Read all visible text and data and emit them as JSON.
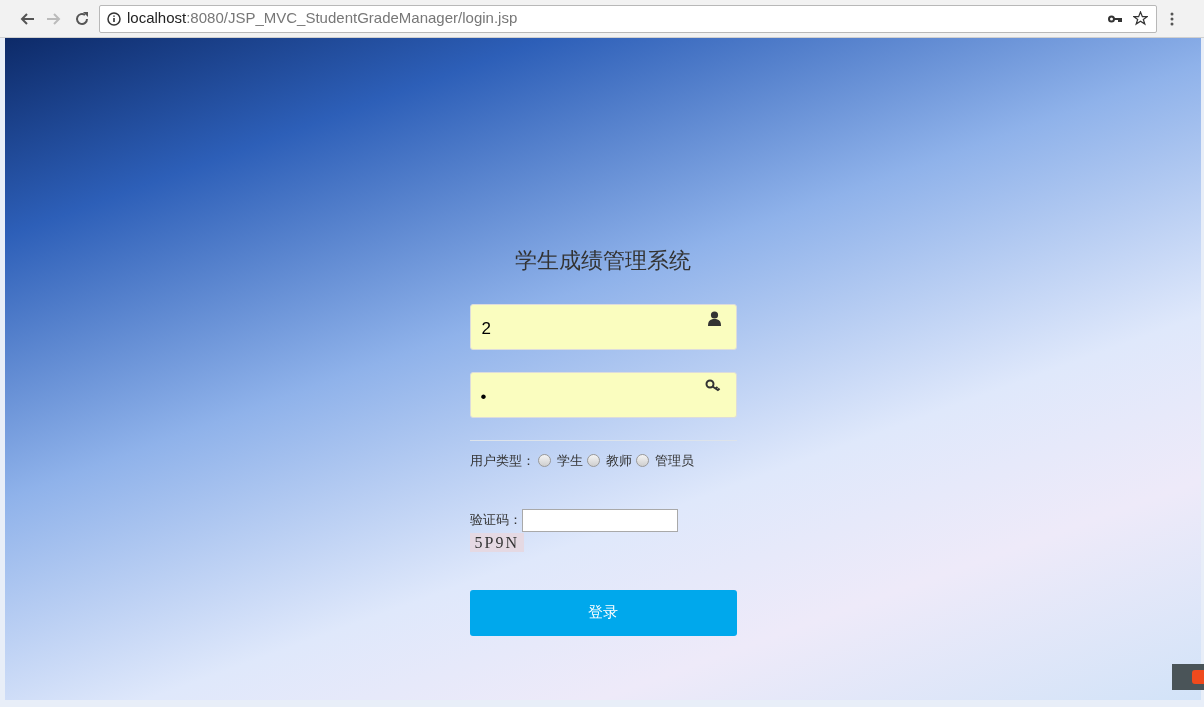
{
  "browser": {
    "url_host": "localhost",
    "url_path": ":8080/JSP_MVC_StudentGradeManager/login.jsp"
  },
  "login": {
    "title": "学生成绩管理系统",
    "username": {
      "value": "2"
    },
    "password": {
      "value": "•"
    },
    "user_type": {
      "label": "用户类型：",
      "options": [
        {
          "label": "学生",
          "selected": false
        },
        {
          "label": "教师",
          "selected": false
        },
        {
          "label": "管理员",
          "selected": false
        }
      ]
    },
    "captcha": {
      "label": "验证码：",
      "code": "5P9N"
    },
    "submit": "登录"
  }
}
